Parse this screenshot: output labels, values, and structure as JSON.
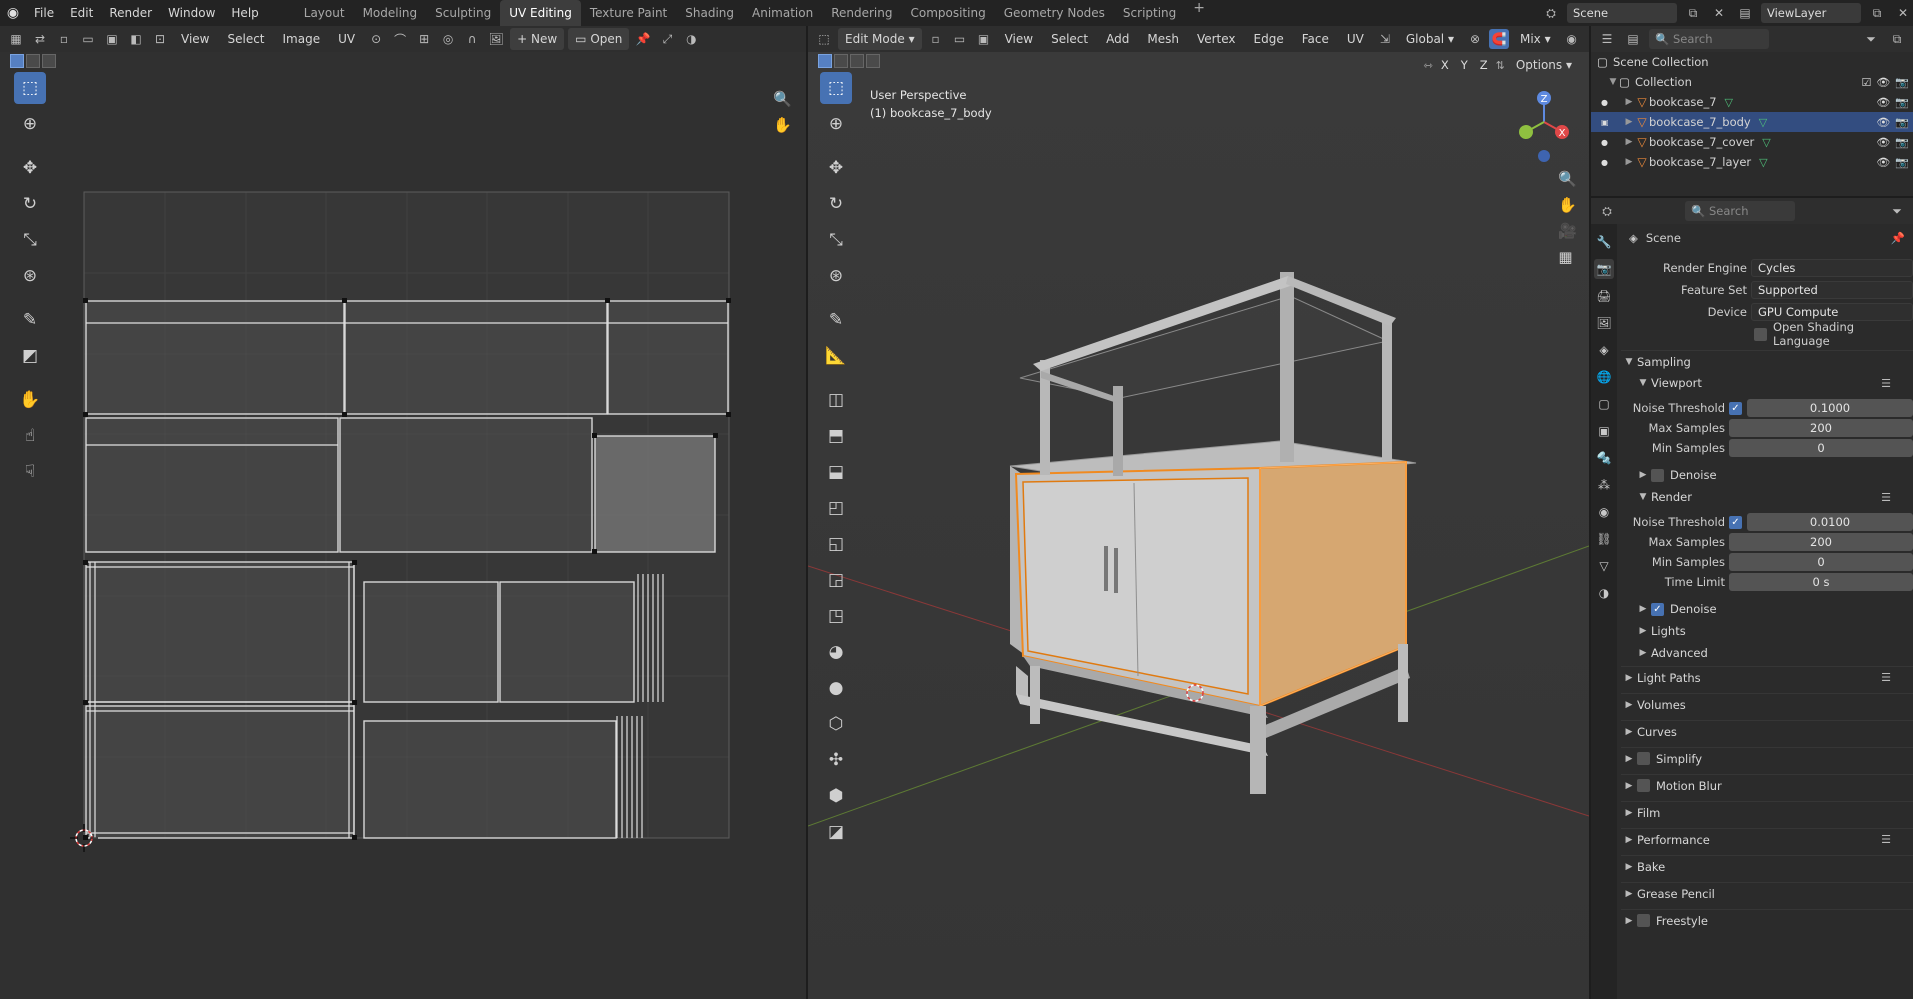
{
  "topbar": {
    "menus": [
      "File",
      "Edit",
      "Render",
      "Window",
      "Help"
    ],
    "workspaces": [
      "Layout",
      "Modeling",
      "Sculpting",
      "UV Editing",
      "Texture Paint",
      "Shading",
      "Animation",
      "Rendering",
      "Compositing",
      "Geometry Nodes",
      "Scripting"
    ],
    "active_workspace": "UV Editing",
    "scene": "Scene",
    "view_layer": "ViewLayer"
  },
  "uv_editor": {
    "menus": [
      "View",
      "Select",
      "Image",
      "UV"
    ],
    "new_label": "New",
    "open_label": "Open"
  },
  "viewport": {
    "mode": "Edit Mode",
    "menus": [
      "View",
      "Select",
      "Add",
      "Mesh",
      "Vertex",
      "Edge",
      "Face",
      "UV"
    ],
    "transform_orientation": "Global",
    "shading_label": "Mix",
    "options_label": "Options",
    "axis_labels": [
      "X",
      "Y",
      "Z"
    ],
    "overlay_line1": "User Perspective",
    "overlay_line2": "(1) bookcase_7_body"
  },
  "outliner": {
    "search_placeholder": "Search",
    "root": "Scene Collection",
    "collection": "Collection",
    "objects": [
      "bookcase_7",
      "bookcase_7_body",
      "bookcase_7_cover",
      "bookcase_7_layer"
    ],
    "selected": "bookcase_7_body"
  },
  "properties": {
    "search_placeholder": "Search",
    "context": "Scene",
    "render_engine_label": "Render Engine",
    "render_engine": "Cycles",
    "feature_set_label": "Feature Set",
    "feature_set": "Supported",
    "device_label": "Device",
    "device": "GPU Compute",
    "osl_label": "Open Shading Language",
    "sampling": "Sampling",
    "viewport_label": "Viewport",
    "noise_threshold_label": "Noise Threshold",
    "viewport_noise_threshold": "0.1000",
    "max_samples_label": "Max Samples",
    "viewport_max_samples": "200",
    "min_samples_label": "Min Samples",
    "viewport_min_samples": "0",
    "denoise_label": "Denoise",
    "render_label": "Render",
    "render_noise_threshold": "0.0100",
    "render_max_samples": "200",
    "render_min_samples": "0",
    "time_limit_label": "Time Limit",
    "time_limit": "0 s",
    "lights_label": "Lights",
    "advanced_label": "Advanced",
    "panels": [
      "Light Paths",
      "Volumes",
      "Curves",
      "Simplify",
      "Motion Blur",
      "Film",
      "Performance",
      "Bake",
      "Grease Pencil",
      "Freestyle"
    ]
  },
  "colors": {
    "accent": "#4772b3",
    "selection_orange": "#f08a20",
    "selected_row": "#334d80"
  }
}
